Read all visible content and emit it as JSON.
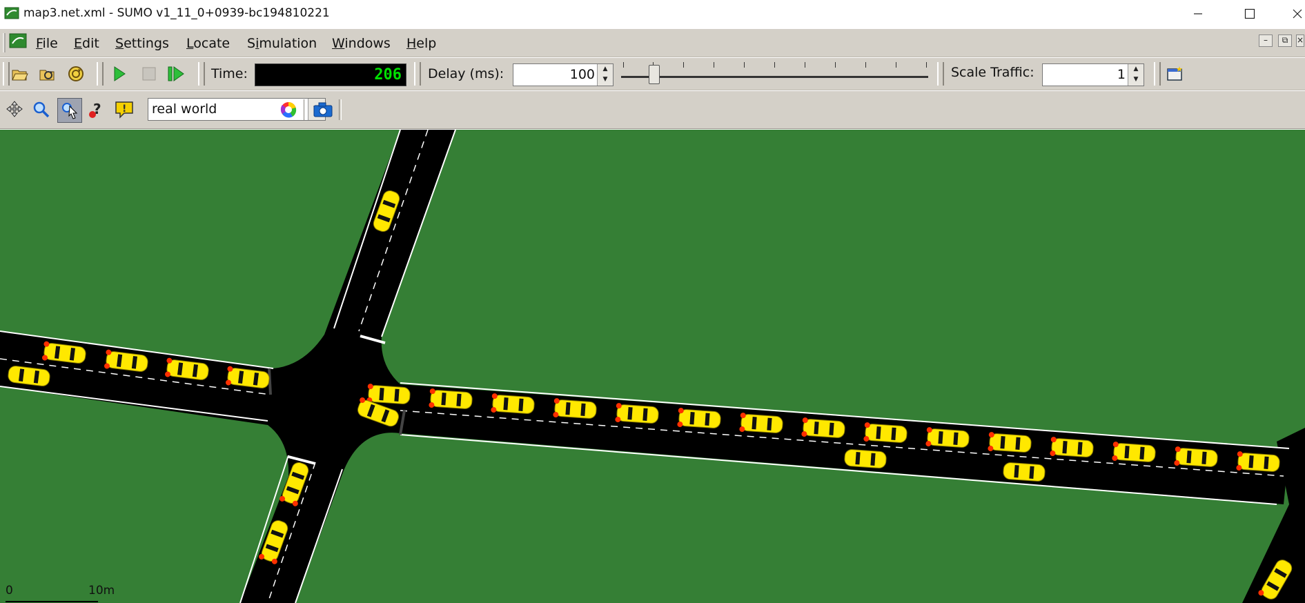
{
  "window": {
    "title": "map3.net.xml - SUMO v1_11_0+0939-bc194810221",
    "controls": [
      "minimize",
      "maximize",
      "close"
    ]
  },
  "menu": {
    "items": [
      {
        "label": "File",
        "mnemonic": "F"
      },
      {
        "label": "Edit",
        "mnemonic": "E"
      },
      {
        "label": "Settings",
        "mnemonic": "S"
      },
      {
        "label": "Locate",
        "mnemonic": "L"
      },
      {
        "label": "Simulation",
        "mnemonic": "i"
      },
      {
        "label": "Windows",
        "mnemonic": "W"
      },
      {
        "label": "Help",
        "mnemonic": "H"
      }
    ]
  },
  "toolbar": {
    "time_label": "Time:",
    "time_value": "206",
    "delay_label": "Delay (ms):",
    "delay_value": "100",
    "scale_label": "Scale Traffic:",
    "scale_value": "1",
    "icons": [
      "open-icon",
      "reload-icon",
      "reload-sim-icon",
      "run-icon",
      "stop-icon",
      "step-icon"
    ]
  },
  "view_toolbar": {
    "scheme": "real world",
    "icons": [
      "recenter-icon",
      "locate-icon",
      "select-icon",
      "help-icon",
      "annotate-icon",
      "color-wheel-icon",
      "screenshot-icon"
    ]
  },
  "scale_bar": {
    "start": "0",
    "end": "10m"
  },
  "colors": {
    "grass": "#357f35",
    "road": "#000000",
    "vehicle": "#ffe800",
    "time_digits": "#00e000"
  }
}
